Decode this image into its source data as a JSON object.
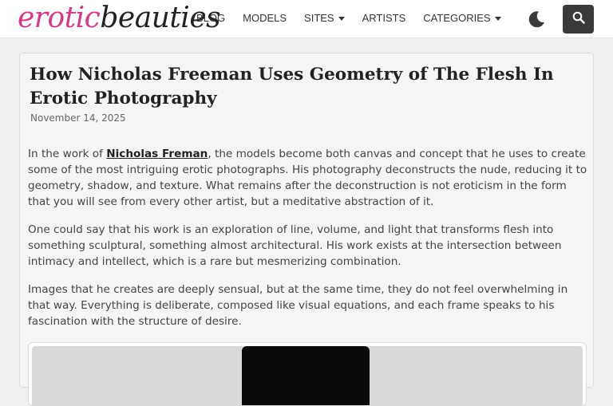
{
  "logo": {
    "part1": "erotic",
    "part2": "beauties"
  },
  "nav": {
    "items": [
      {
        "label": "BLOG",
        "dropdown": false
      },
      {
        "label": "MODELS",
        "dropdown": false
      },
      {
        "label": "SITES",
        "dropdown": true
      },
      {
        "label": "ARTISTS",
        "dropdown": false
      },
      {
        "label": "CATEGORIES",
        "dropdown": true
      }
    ]
  },
  "header_icons": {
    "theme_toggle": "moon-icon",
    "search": "search-icon"
  },
  "article": {
    "title": "How Nicholas Freeman Uses Geometry of The Flesh In Erotic Photography",
    "date": "November 14, 2025",
    "p1": {
      "before": "In the work of ",
      "link": "Nicholas Freman",
      "after": ", the models become both canvas and concept that he uses to create some of the most intriguing erotic photographs. His photography deconstructs the nude, reducing it to geometry, shadow, and texture. What remains after the deconstruction is not eroticism in the form that you will see from every other artist, but a meditative abstraction of it."
    },
    "p2": "One could say that his work is an exploration of line, volume, and light that transforms flesh into something sculptural, something almost architectural. His work exists at the intersection between intimacy and intellect, which is a rare but mesmerizing combination.",
    "p3": "Images that he creates are deeply sensual, but at the same time, they do not feel overwhelming in that way. Everything is deliberate, composed like visual equations, and each frame speaks to his fascination with the structure of desire."
  },
  "colors": {
    "brand_pink": "#d63a86",
    "search_bg": "#3a3a3a",
    "page_bg": "#efefef"
  }
}
